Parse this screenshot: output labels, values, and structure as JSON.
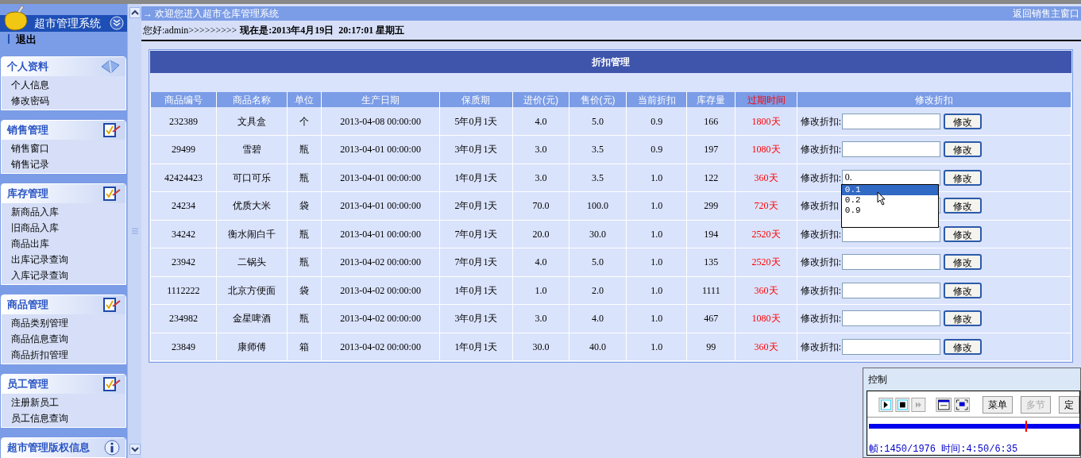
{
  "sidebar": {
    "title": "超市管理系统",
    "logout": "退出",
    "sections": [
      {
        "title": "个人资料",
        "items": [
          "个人信息",
          "修改密码"
        ]
      },
      {
        "title": "销售管理",
        "items": [
          "销售窗口",
          "销售记录"
        ]
      },
      {
        "title": "库存管理",
        "items": [
          "新商品入库",
          "旧商品入库",
          "商品出库",
          "出库记录查询",
          "入库记录查询"
        ]
      },
      {
        "title": "商品管理",
        "items": [
          "商品类别管理",
          "商品信息查询",
          "商品折扣管理"
        ]
      },
      {
        "title": "员工管理",
        "items": [
          "注册新员工",
          "员工信息查询"
        ]
      },
      {
        "title": "超市管理版权信息"
      }
    ]
  },
  "header": {
    "welcome": "→ 欢迎您进入超市仓库管理系统",
    "return_link": "返回销售主窗口"
  },
  "greeting": {
    "user": "您好:admin>>>>>>>>>",
    "now": "现在是:2013年4月19日  20:17:01 星期五"
  },
  "table": {
    "title": "折扣管理",
    "columns": [
      {
        "label": "商品编号",
        "highlight": false
      },
      {
        "label": "商品名称",
        "highlight": false
      },
      {
        "label": "单位",
        "highlight": false
      },
      {
        "label": "生产日期",
        "highlight": false
      },
      {
        "label": "保质期",
        "highlight": false
      },
      {
        "label": "进价(元)",
        "highlight": false
      },
      {
        "label": "售价(元)",
        "highlight": false
      },
      {
        "label": "当前折扣",
        "highlight": false
      },
      {
        "label": "库存量",
        "highlight": false
      },
      {
        "label": "过期时间",
        "highlight": true
      },
      {
        "label": "修改折扣",
        "highlight": false
      }
    ],
    "rows": [
      {
        "cells": [
          "232389",
          "文具盒",
          "个",
          "2013-04-08 00:00:00",
          "5年0月1天",
          "4.0",
          "5.0",
          "0.9",
          "166"
        ],
        "expiry": "1800天",
        "field_label": "修改折扣:",
        "value": "",
        "button": "修改"
      },
      {
        "cells": [
          "29499",
          "雪碧",
          "瓶",
          "2013-04-01 00:00:00",
          "3年0月1天",
          "3.0",
          "3.5",
          "0.9",
          "197"
        ],
        "expiry": "1080天",
        "field_label": "修改折扣:",
        "value": "",
        "button": "修改"
      },
      {
        "cells": [
          "42424423",
          "可口可乐",
          "瓶",
          "2013-04-01 00:00:00",
          "1年0月1天",
          "3.0",
          "3.5",
          "1.0",
          "122"
        ],
        "expiry": "360天",
        "field_label": "修改折扣:",
        "value": "0.",
        "button": "修改",
        "suggestions": [
          {
            "label": "0.1",
            "selected": true
          },
          {
            "label": "0.2",
            "selected": false
          },
          {
            "label": "0.9",
            "selected": false
          }
        ]
      },
      {
        "cells": [
          "24234",
          "优质大米",
          "袋",
          "2013-04-01 00:00:00",
          "2年0月1天",
          "70.0",
          "100.0",
          "1.0",
          "299"
        ],
        "expiry": "720天",
        "field_label": "修改折扣",
        "value": "",
        "button": "修改"
      },
      {
        "cells": [
          "34242",
          "衡水闹白千",
          "瓶",
          "2013-04-01 00:00:00",
          "7年0月1天",
          "20.0",
          "30.0",
          "1.0",
          "194"
        ],
        "expiry": "2520天",
        "field_label": "修改折扣:",
        "value": "",
        "button": "修改"
      },
      {
        "cells": [
          "23942",
          "二锅头",
          "瓶",
          "2013-04-02 00:00:00",
          "7年0月1天",
          "4.0",
          "5.0",
          "1.0",
          "135"
        ],
        "expiry": "2520天",
        "field_label": "修改折扣:",
        "value": "",
        "button": "修改"
      },
      {
        "cells": [
          "1112222",
          "北京方便面",
          "袋",
          "2013-04-02 00:00:00",
          "1年0月1天",
          "1.0",
          "2.0",
          "1.0",
          "1111"
        ],
        "expiry": "360天",
        "field_label": "修改折扣:",
        "value": "",
        "button": "修改"
      },
      {
        "cells": [
          "234982",
          "金星啤酒",
          "瓶",
          "2013-04-02 00:00:00",
          "3年0月1天",
          "3.0",
          "4.0",
          "1.0",
          "467"
        ],
        "expiry": "1080天",
        "field_label": "修改折扣:",
        "value": "",
        "button": "修改"
      },
      {
        "cells": [
          "23849",
          "康师傅",
          "箱",
          "2013-04-02 00:00:00",
          "1年0月1天",
          "30.0",
          "40.0",
          "1.0",
          "99"
        ],
        "expiry": "360天",
        "field_label": "修改折扣:",
        "value": "",
        "button": "修改"
      }
    ]
  },
  "player": {
    "title": "控制",
    "buttons": [
      {
        "label": "菜单",
        "disabled": false
      },
      {
        "label": "多节",
        "disabled": true
      },
      {
        "label": "定",
        "disabled": false
      }
    ],
    "level": 0.73,
    "status": "帧:1450/1976 时间:4:50/6:35"
  }
}
